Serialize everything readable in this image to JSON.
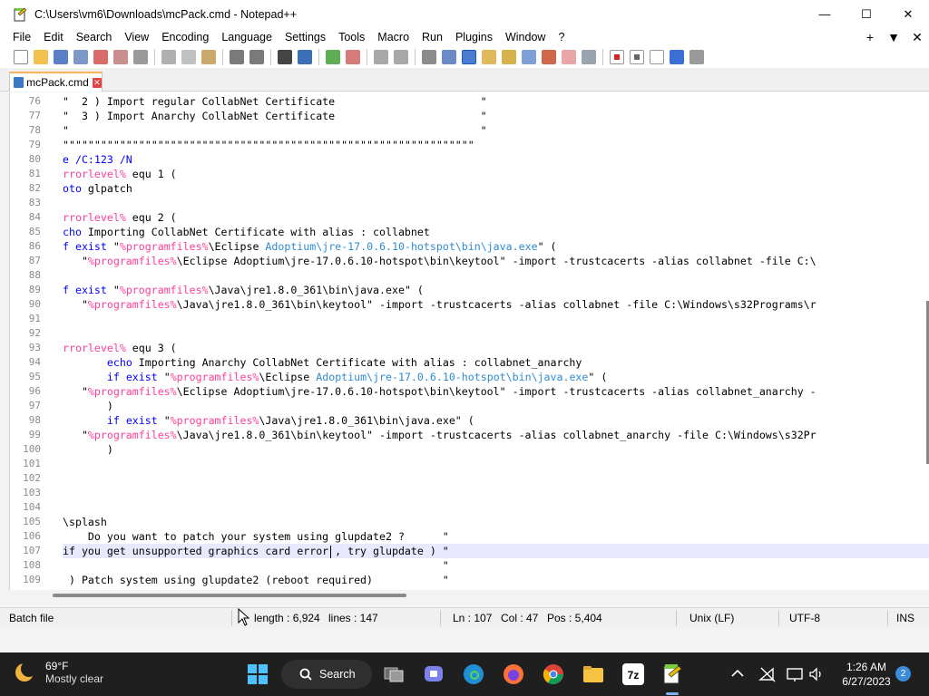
{
  "window": {
    "title": "C:\\Users\\vm6\\Downloads\\mcPack.cmd - Notepad++",
    "minimize_glyph": "—",
    "maximize_glyph": "☐",
    "close_glyph": "✕"
  },
  "menu": {
    "items": [
      "File",
      "Edit",
      "Search",
      "View",
      "Encoding",
      "Language",
      "Settings",
      "Tools",
      "Macro",
      "Run",
      "Plugins",
      "Window",
      "?"
    ],
    "right_glyphs": [
      "+",
      "▼",
      "✕"
    ]
  },
  "toolbar": {
    "icons": [
      "new-file-icon",
      "open-file-icon",
      "save-icon",
      "save-all-icon",
      "close-icon",
      "close-all-icon",
      "print-icon",
      "cut-icon",
      "copy-icon",
      "paste-icon",
      "undo-icon",
      "redo-icon",
      "find-icon",
      "replace-icon",
      "zoom-in-icon",
      "zoom-out-icon",
      "sync-vertical-icon",
      "sync-horizontal-icon",
      "word-wrap-icon",
      "show-all-chars-icon",
      "indent-guide-icon",
      "udl-icon",
      "doc-map-icon",
      "function-list-icon",
      "folder-as-workspace-icon",
      "monitoring-icon",
      "record-macro-icon",
      "stop-record-icon",
      "play-macro-icon",
      "run-macro-multiple-icon",
      "save-macro-icon"
    ]
  },
  "tab": {
    "label": "mcPack.cmd"
  },
  "editor": {
    "lines": [
      {
        "n": "76",
        "segs": [
          {
            "t": "\"  2 ) Import regular CollabNet Certificate                       \""
          }
        ]
      },
      {
        "n": "77",
        "segs": [
          {
            "t": "\"  3 ) Import Anarchy CollabNet Certificate                       \""
          }
        ]
      },
      {
        "n": "78",
        "segs": [
          {
            "t": "\"                                                                 \""
          }
        ]
      },
      {
        "n": "79",
        "segs": [
          {
            "t": "\"\"\"\"\"\"\"\"\"\"\"\"\"\"\"\"\"\"\"\"\"\"\"\"\"\"\"\"\"\"\"\"\"\"\"\"\"\"\"\"\"\"\"\"\"\"\"\"\"\"\"\"\"\"\"\"\"\"\"\"\"\"\"\"\""
          }
        ]
      },
      {
        "n": "80",
        "segs": [
          {
            "t": "e /C:123 /N",
            "c": "k1"
          }
        ]
      },
      {
        "n": "81",
        "segs": [
          {
            "t": "rrorlevel%",
            "c": "v"
          },
          {
            "t": " equ 1 ("
          }
        ]
      },
      {
        "n": "82",
        "segs": [
          {
            "t": "oto",
            "c": "k"
          },
          {
            "t": " glpatch"
          }
        ]
      },
      {
        "n": "83",
        "segs": [
          {
            "t": ""
          }
        ]
      },
      {
        "n": "84",
        "segs": [
          {
            "t": "rrorlevel%",
            "c": "v"
          },
          {
            "t": " equ 2 ("
          }
        ]
      },
      {
        "n": "85",
        "segs": [
          {
            "t": "cho",
            "c": "k"
          },
          {
            "t": " Importing CollabNet Certificate with alias : collabnet"
          }
        ]
      },
      {
        "n": "86",
        "segs": [
          {
            "t": "f exist",
            "c": "k"
          },
          {
            "t": " \""
          },
          {
            "t": "%programfiles%",
            "c": "v"
          },
          {
            "t": "\\Eclipse "
          },
          {
            "t": "Adoptium\\jre-17.0.6.10-hotspot\\bin\\java.exe",
            "c": "p"
          },
          {
            "t": "\" ("
          }
        ]
      },
      {
        "n": "87",
        "segs": [
          {
            "t": "   \""
          },
          {
            "t": "%programfiles%",
            "c": "v"
          },
          {
            "t": "\\Eclipse Adoptium\\jre-17.0.6.10-hotspot\\bin\\keytool\" -import -trustcacerts -alias collabnet -file C:\\"
          }
        ]
      },
      {
        "n": "88",
        "segs": [
          {
            "t": ""
          }
        ]
      },
      {
        "n": "89",
        "segs": [
          {
            "t": "f exist",
            "c": "k"
          },
          {
            "t": " \""
          },
          {
            "t": "%programfiles%",
            "c": "v"
          },
          {
            "t": "\\Java\\jre1.8.0_361\\bin\\java.exe\" ("
          }
        ]
      },
      {
        "n": "90",
        "segs": [
          {
            "t": "   \""
          },
          {
            "t": "%programfiles%",
            "c": "v"
          },
          {
            "t": "\\Java\\jre1.8.0_361\\bin\\keytool\" -import -trustcacerts -alias collabnet -file C:\\Windows\\s32Programs\\r"
          }
        ]
      },
      {
        "n": "91",
        "segs": [
          {
            "t": ""
          }
        ]
      },
      {
        "n": "92",
        "segs": [
          {
            "t": ""
          }
        ]
      },
      {
        "n": "93",
        "segs": [
          {
            "t": "rrorlevel%",
            "c": "v"
          },
          {
            "t": " equ 3 ("
          }
        ]
      },
      {
        "n": "94",
        "segs": [
          {
            "t": "       "
          },
          {
            "t": "echo",
            "c": "k"
          },
          {
            "t": " Importing Anarchy CollabNet Certificate with alias : collabnet_anarchy"
          }
        ]
      },
      {
        "n": "95",
        "segs": [
          {
            "t": "       "
          },
          {
            "t": "if exist",
            "c": "k"
          },
          {
            "t": " \""
          },
          {
            "t": "%programfiles%",
            "c": "v"
          },
          {
            "t": "\\Eclipse "
          },
          {
            "t": "Adoptium\\jre-17.0.6.10-hotspot\\bin\\java.exe",
            "c": "p"
          },
          {
            "t": "\" ("
          }
        ]
      },
      {
        "n": "96",
        "segs": [
          {
            "t": "   \""
          },
          {
            "t": "%programfiles%",
            "c": "v"
          },
          {
            "t": "\\Eclipse Adoptium\\jre-17.0.6.10-hotspot\\bin\\keytool\" -import -trustcacerts -alias collabnet_anarchy -"
          }
        ]
      },
      {
        "n": "97",
        "segs": [
          {
            "t": "       )"
          }
        ]
      },
      {
        "n": "98",
        "segs": [
          {
            "t": "       "
          },
          {
            "t": "if exist",
            "c": "k"
          },
          {
            "t": " \""
          },
          {
            "t": "%programfiles%",
            "c": "v"
          },
          {
            "t": "\\Java\\jre1.8.0_361\\bin\\java.exe\" ("
          }
        ]
      },
      {
        "n": "99",
        "segs": [
          {
            "t": "   \""
          },
          {
            "t": "%programfiles%",
            "c": "v"
          },
          {
            "t": "\\Java\\jre1.8.0_361\\bin\\keytool\" -import -trustcacerts -alias collabnet_anarchy -file C:\\Windows\\s32Pr"
          }
        ]
      },
      {
        "n": "100",
        "segs": [
          {
            "t": "       )"
          }
        ]
      },
      {
        "n": "101",
        "segs": [
          {
            "t": ""
          }
        ]
      },
      {
        "n": "102",
        "segs": [
          {
            "t": ""
          }
        ]
      },
      {
        "n": "103",
        "segs": [
          {
            "t": ""
          }
        ]
      },
      {
        "n": "104",
        "segs": [
          {
            "t": ""
          }
        ]
      },
      {
        "n": "105",
        "segs": [
          {
            "t": "\\splash"
          }
        ]
      },
      {
        "n": "106",
        "segs": [
          {
            "t": "    Do you want to patch your system using glupdate2 ?      \""
          }
        ]
      },
      {
        "n": "107",
        "segs": [
          {
            "t": "if you get unsupported graphics card error , try glupdate ) \""
          }
        ],
        "current": true
      },
      {
        "n": "108",
        "segs": [
          {
            "t": "                                                            \""
          }
        ]
      },
      {
        "n": "109",
        "segs": [
          {
            "t": " ) Patch system using glupdate2 (reboot required)           \""
          }
        ]
      }
    ]
  },
  "status": {
    "language": "Batch file",
    "length": "length : 6,924",
    "lines": "lines : 147",
    "ln": "Ln : 107",
    "col": "Col : 47",
    "pos": "Pos : 5,404",
    "eol": "Unix (LF)",
    "encoding": "UTF-8",
    "mode": "INS"
  },
  "taskbar": {
    "weather_temp": "69°F",
    "weather_cond": "Mostly clear",
    "search_label": "Search",
    "time": "1:26 AM",
    "date": "6/27/2023",
    "notifications": "2"
  },
  "colors": {
    "accent_tab": "#f7b25f",
    "variable": "#ff3d9a",
    "keyword": "#0000ff",
    "path": "#2e8bd4",
    "current_line": "#e8e8ff"
  }
}
